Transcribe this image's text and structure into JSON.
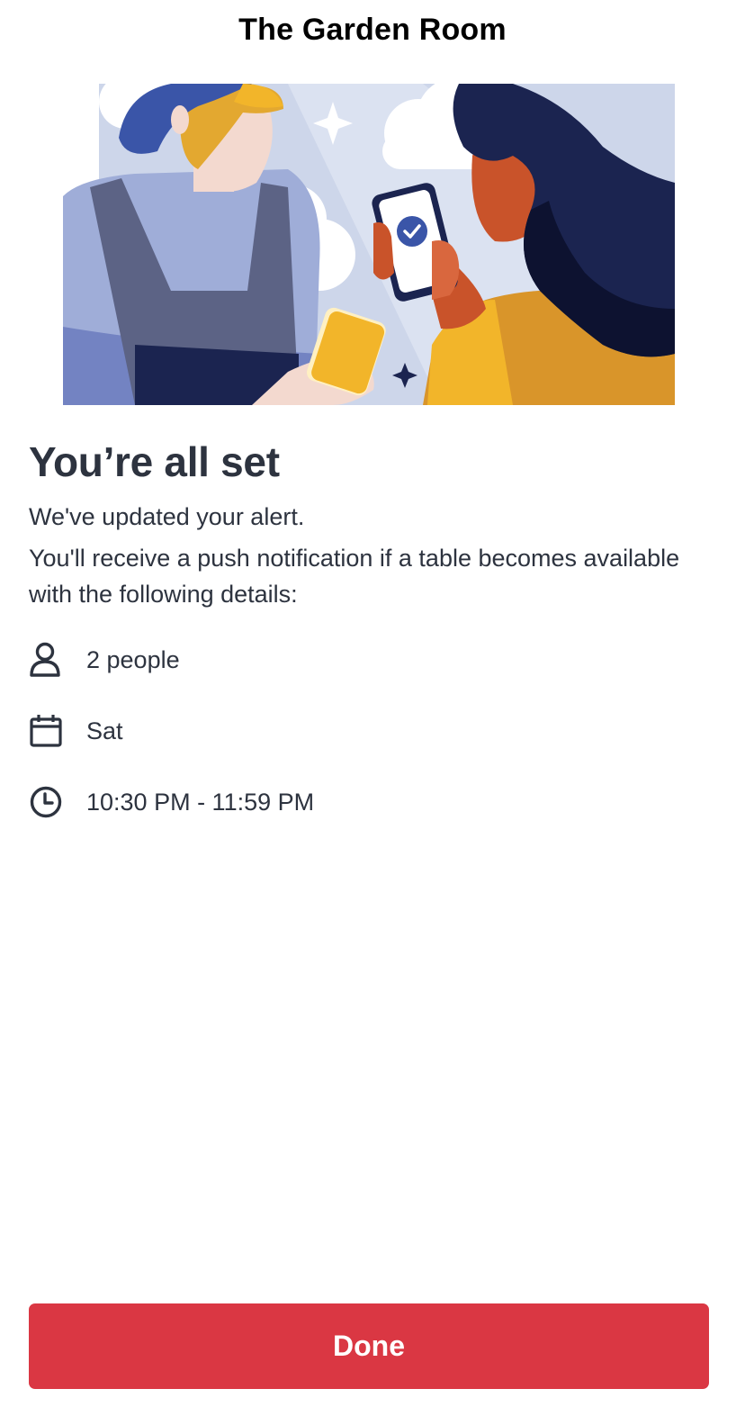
{
  "header": {
    "title": "The Garden Room"
  },
  "confirmation": {
    "headline": "You’re all set",
    "line1": "We've updated your alert.",
    "line2": "You'll receive a push notification if a table becomes available with the following details:"
  },
  "details": [
    {
      "icon": "person-icon",
      "text": "2 people"
    },
    {
      "icon": "calendar-icon",
      "text": "Sat"
    },
    {
      "icon": "clock-icon",
      "text": "10:30 PM - 11:59 PM"
    }
  ],
  "actions": {
    "done_label": "Done"
  },
  "colors": {
    "accent": "#da3743",
    "text": "#2d333f"
  }
}
